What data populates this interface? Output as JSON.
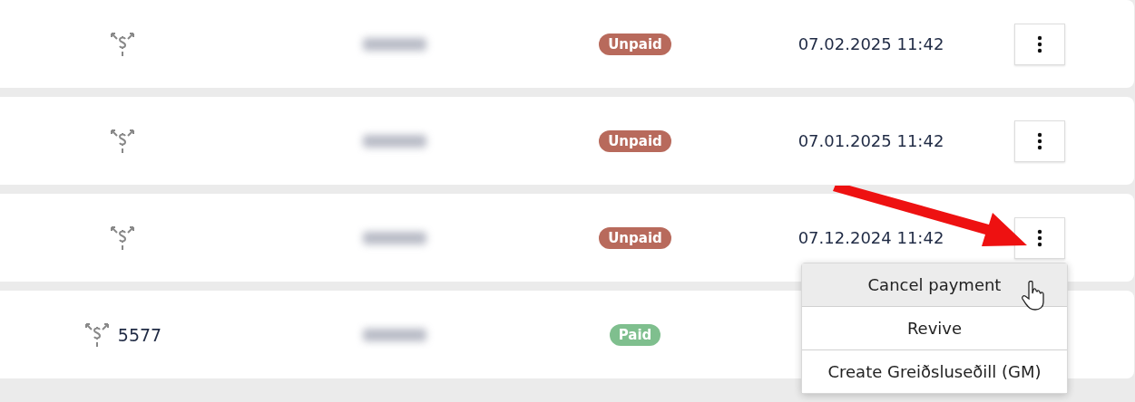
{
  "rows": [
    {
      "reference": null,
      "status": {
        "label": "Unpaid",
        "kind": "unpaid"
      },
      "date": "07.02.2025 11:42"
    },
    {
      "reference": null,
      "status": {
        "label": "Unpaid",
        "kind": "unpaid"
      },
      "date": "07.01.2025 11:42"
    },
    {
      "reference": null,
      "status": {
        "label": "Unpaid",
        "kind": "unpaid"
      },
      "date": "07.12.2024 11:42",
      "menu": [
        {
          "label": "Cancel payment",
          "selected": true
        },
        {
          "label": "Revive",
          "selected": false
        },
        {
          "label": "Create Greiðsluseðill (GM)",
          "selected": false
        }
      ]
    },
    {
      "reference": "5577",
      "status": {
        "label": "Paid",
        "kind": "paid"
      }
    }
  ]
}
